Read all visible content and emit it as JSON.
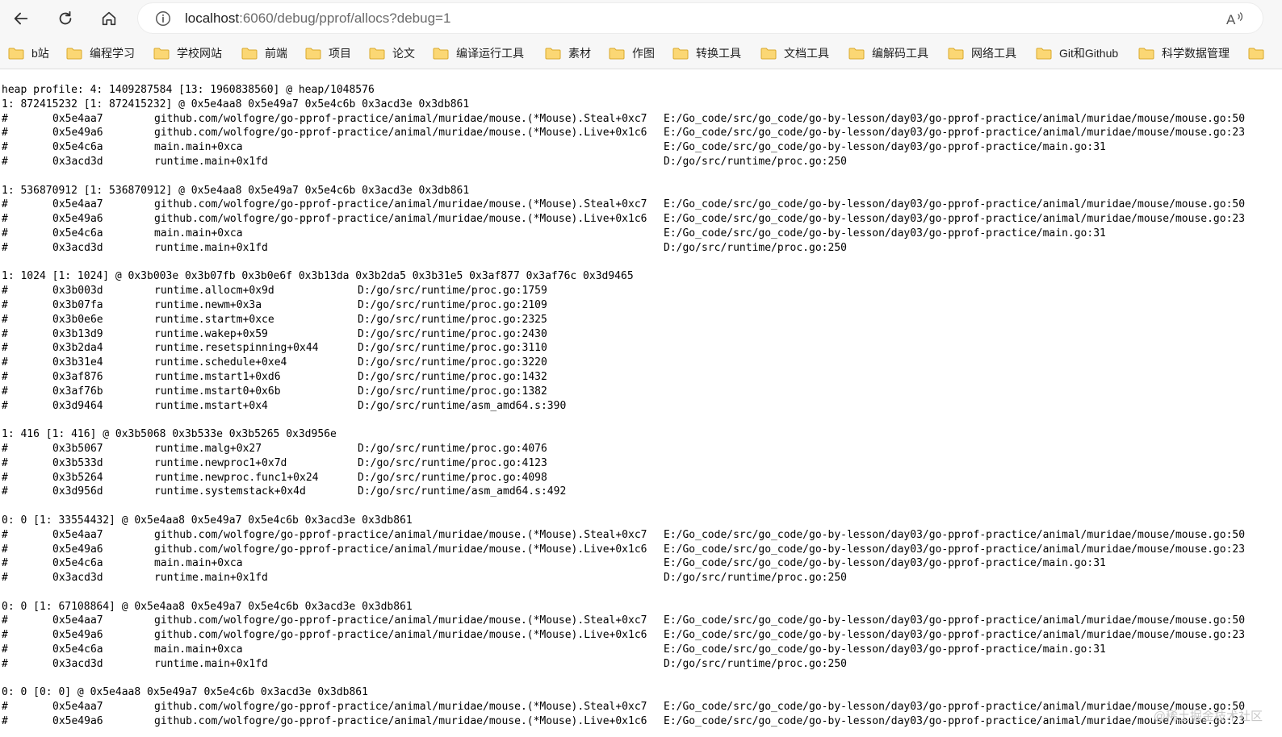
{
  "browser": {
    "url_host": "localhost",
    "url_rest": ":6060/debug/pprof/allocs?debug=1"
  },
  "bookmarks": [
    "b站",
    "编程学习",
    "学校网站",
    "前端",
    "项目",
    "论文",
    "编译运行工具",
    "素材",
    "作图",
    "转换工具",
    "文档工具",
    "编解码工具",
    "网络工具",
    "Git和Github",
    "科学数据管理"
  ],
  "profile": {
    "header": "heap profile: 4: 1409287584 [13: 1960838560] @ heap/1048576",
    "records": [
      {
        "head": "1: 872415232 [1: 872415232] @ 0x5e4aa8 0x5e49a7 0x5e4c6b 0x3acd3e 0x3db861",
        "long": true,
        "frames": [
          [
            "#",
            "0x5e4aa7",
            "github.com/wolfogre/go-pprof-practice/animal/muridae/mouse.(*Mouse).Steal+0xc7",
            "E:/Go_code/src/go_code/go-by-lesson/day03/go-pprof-practice/animal/muridae/mouse/mouse.go:50"
          ],
          [
            "#",
            "0x5e49a6",
            "github.com/wolfogre/go-pprof-practice/animal/muridae/mouse.(*Mouse).Live+0x1c6",
            "E:/Go_code/src/go_code/go-by-lesson/day03/go-pprof-practice/animal/muridae/mouse/mouse.go:23"
          ],
          [
            "#",
            "0x5e4c6a",
            "main.main+0xca",
            "E:/Go_code/src/go_code/go-by-lesson/day03/go-pprof-practice/main.go:31"
          ],
          [
            "#",
            "0x3acd3d",
            "runtime.main+0x1fd",
            "D:/go/src/runtime/proc.go:250"
          ]
        ]
      },
      {
        "head": "1: 536870912 [1: 536870912] @ 0x5e4aa8 0x5e49a7 0x5e4c6b 0x3acd3e 0x3db861",
        "long": true,
        "frames": [
          [
            "#",
            "0x5e4aa7",
            "github.com/wolfogre/go-pprof-practice/animal/muridae/mouse.(*Mouse).Steal+0xc7",
            "E:/Go_code/src/go_code/go-by-lesson/day03/go-pprof-practice/animal/muridae/mouse/mouse.go:50"
          ],
          [
            "#",
            "0x5e49a6",
            "github.com/wolfogre/go-pprof-practice/animal/muridae/mouse.(*Mouse).Live+0x1c6",
            "E:/Go_code/src/go_code/go-by-lesson/day03/go-pprof-practice/animal/muridae/mouse/mouse.go:23"
          ],
          [
            "#",
            "0x5e4c6a",
            "main.main+0xca",
            "E:/Go_code/src/go_code/go-by-lesson/day03/go-pprof-practice/main.go:31"
          ],
          [
            "#",
            "0x3acd3d",
            "runtime.main+0x1fd",
            "D:/go/src/runtime/proc.go:250"
          ]
        ]
      },
      {
        "head": "1: 1024 [1: 1024] @ 0x3b003e 0x3b07fb 0x3b0e6f 0x3b13da 0x3b2da5 0x3b31e5 0x3af877 0x3af76c 0x3d9465",
        "long": false,
        "frames": [
          [
            "#",
            "0x3b003d",
            "runtime.allocm+0x9d",
            "D:/go/src/runtime/proc.go:1759"
          ],
          [
            "#",
            "0x3b07fa",
            "runtime.newm+0x3a",
            "D:/go/src/runtime/proc.go:2109"
          ],
          [
            "#",
            "0x3b0e6e",
            "runtime.startm+0xce",
            "D:/go/src/runtime/proc.go:2325"
          ],
          [
            "#",
            "0x3b13d9",
            "runtime.wakep+0x59",
            "D:/go/src/runtime/proc.go:2430"
          ],
          [
            "#",
            "0x3b2da4",
            "runtime.resetspinning+0x44",
            "D:/go/src/runtime/proc.go:3110"
          ],
          [
            "#",
            "0x3b31e4",
            "runtime.schedule+0xe4",
            "D:/go/src/runtime/proc.go:3220"
          ],
          [
            "#",
            "0x3af876",
            "runtime.mstart1+0xd6",
            "D:/go/src/runtime/proc.go:1432"
          ],
          [
            "#",
            "0x3af76b",
            "runtime.mstart0+0x6b",
            "D:/go/src/runtime/proc.go:1382"
          ],
          [
            "#",
            "0x3d9464",
            "runtime.mstart+0x4",
            "D:/go/src/runtime/asm_amd64.s:390"
          ]
        ]
      },
      {
        "head": "1: 416 [1: 416] @ 0x3b5068 0x3b533e 0x3b5265 0x3d956e",
        "long": false,
        "frames": [
          [
            "#",
            "0x3b5067",
            "runtime.malg+0x27",
            "D:/go/src/runtime/proc.go:4076"
          ],
          [
            "#",
            "0x3b533d",
            "runtime.newproc1+0x7d",
            "D:/go/src/runtime/proc.go:4123"
          ],
          [
            "#",
            "0x3b5264",
            "runtime.newproc.func1+0x24",
            "D:/go/src/runtime/proc.go:4098"
          ],
          [
            "#",
            "0x3d956d",
            "runtime.systemstack+0x4d",
            "D:/go/src/runtime/asm_amd64.s:492"
          ]
        ]
      },
      {
        "head": "0: 0 [1: 33554432] @ 0x5e4aa8 0x5e49a7 0x5e4c6b 0x3acd3e 0x3db861",
        "long": true,
        "frames": [
          [
            "#",
            "0x5e4aa7",
            "github.com/wolfogre/go-pprof-practice/animal/muridae/mouse.(*Mouse).Steal+0xc7",
            "E:/Go_code/src/go_code/go-by-lesson/day03/go-pprof-practice/animal/muridae/mouse/mouse.go:50"
          ],
          [
            "#",
            "0x5e49a6",
            "github.com/wolfogre/go-pprof-practice/animal/muridae/mouse.(*Mouse).Live+0x1c6",
            "E:/Go_code/src/go_code/go-by-lesson/day03/go-pprof-practice/animal/muridae/mouse/mouse.go:23"
          ],
          [
            "#",
            "0x5e4c6a",
            "main.main+0xca",
            "E:/Go_code/src/go_code/go-by-lesson/day03/go-pprof-practice/main.go:31"
          ],
          [
            "#",
            "0x3acd3d",
            "runtime.main+0x1fd",
            "D:/go/src/runtime/proc.go:250"
          ]
        ]
      },
      {
        "head": "0: 0 [1: 67108864] @ 0x5e4aa8 0x5e49a7 0x5e4c6b 0x3acd3e 0x3db861",
        "long": true,
        "frames": [
          [
            "#",
            "0x5e4aa7",
            "github.com/wolfogre/go-pprof-practice/animal/muridae/mouse.(*Mouse).Steal+0xc7",
            "E:/Go_code/src/go_code/go-by-lesson/day03/go-pprof-practice/animal/muridae/mouse/mouse.go:50"
          ],
          [
            "#",
            "0x5e49a6",
            "github.com/wolfogre/go-pprof-practice/animal/muridae/mouse.(*Mouse).Live+0x1c6",
            "E:/Go_code/src/go_code/go-by-lesson/day03/go-pprof-practice/animal/muridae/mouse/mouse.go:23"
          ],
          [
            "#",
            "0x5e4c6a",
            "main.main+0xca",
            "E:/Go_code/src/go_code/go-by-lesson/day03/go-pprof-practice/main.go:31"
          ],
          [
            "#",
            "0x3acd3d",
            "runtime.main+0x1fd",
            "D:/go/src/runtime/proc.go:250"
          ]
        ]
      },
      {
        "head": "0: 0 [0: 0] @ 0x5e4aa8 0x5e49a7 0x5e4c6b 0x3acd3e 0x3db861",
        "long": true,
        "frames": [
          [
            "#",
            "0x5e4aa7",
            "github.com/wolfogre/go-pprof-practice/animal/muridae/mouse.(*Mouse).Steal+0xc7",
            "E:/Go_code/src/go_code/go-by-lesson/day03/go-pprof-practice/animal/muridae/mouse/mouse.go:50"
          ],
          [
            "#",
            "0x5e49a6",
            "github.com/wolfogre/go-pprof-practice/animal/muridae/mouse.(*Mouse).Live+0x1c6",
            "E:/Go_code/src/go_code/go-by-lesson/day03/go-pprof-practice/animal/muridae/mouse/mouse.go:23"
          ]
        ]
      }
    ]
  },
  "watermark": "@稀土掘金技术社区"
}
